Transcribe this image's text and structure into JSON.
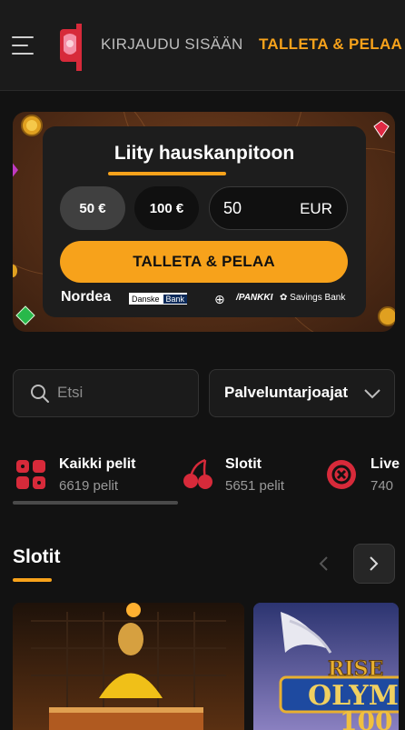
{
  "header": {
    "login_label": "KIRJAUDU SISÄÄN",
    "deposit_label": "TALLETA & PELAA"
  },
  "banner": {
    "title": "Liity hauskanpitoon",
    "amounts": [
      "50 €",
      "100 €"
    ],
    "input_value": "50",
    "currency": "EUR",
    "cta_label": "TALLETA & PELAA",
    "banks": {
      "nordea": "Nordea",
      "danske_a": "Danske",
      "danske_b": "Bank",
      "circle": "⊕",
      "pankki": "/PANKKI",
      "savings": "Savings Bank"
    }
  },
  "search": {
    "placeholder": "Etsi"
  },
  "provider": {
    "label": "Palveluntarjoajat"
  },
  "categories": [
    {
      "name": "Kaikki pelit",
      "count": "6619 pelit"
    },
    {
      "name": "Slotit",
      "count": "5651 pelit"
    },
    {
      "name": "Live",
      "count": "740"
    }
  ],
  "section": {
    "title": "Slotit"
  },
  "colors": {
    "accent": "#f7a21b",
    "brand_red": "#d72a3a",
    "background": "#121212"
  }
}
